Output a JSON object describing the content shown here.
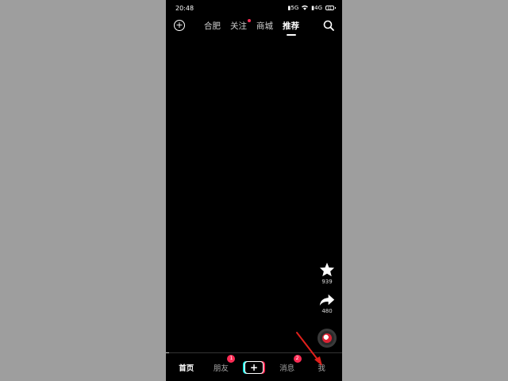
{
  "status_bar": {
    "time": "20:48",
    "icons": [
      "signal-icon",
      "wifi-icon",
      "signal-icon-2",
      "battery-icon"
    ],
    "signal1": "5G",
    "signal2": "4G",
    "battery": "61"
  },
  "top_nav": {
    "tabs": [
      {
        "label": "合肥",
        "active": false
      },
      {
        "label": "关注",
        "active": false,
        "dot": true
      },
      {
        "label": "商城",
        "active": false
      },
      {
        "label": "推荐",
        "active": true
      }
    ]
  },
  "side_actions": {
    "favorite_count": "939",
    "share_count": "480"
  },
  "bottom_nav": {
    "items": [
      {
        "label": "首页",
        "active": true
      },
      {
        "label": "朋友",
        "badge": "1"
      },
      {
        "label": "+"
      },
      {
        "label": "消息",
        "badge": "2"
      },
      {
        "label": "我"
      }
    ]
  },
  "colors": {
    "background": "#9e9e9e",
    "screen": "#000000",
    "accent": "#fe2c55",
    "cyan": "#25f4ee",
    "annotation": "#e0201c"
  }
}
